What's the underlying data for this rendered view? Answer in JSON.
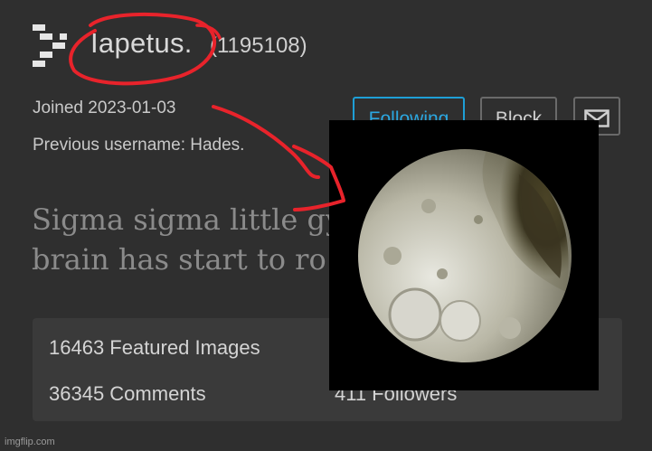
{
  "profile": {
    "username": "Iapetus.",
    "user_id": "(1195108)",
    "joined": "Joined 2023-01-03",
    "previous_username": "Previous username: Hades.",
    "bio": [
      "Sigma sigma little gy",
      "brain has start to ro"
    ]
  },
  "actions": {
    "following_label": "Following",
    "block_label": "Block",
    "message_icon": "envelope-icon"
  },
  "stats": {
    "featured": "16463 Featured Images",
    "comments": "36345 Comments",
    "followers": "411 Followers"
  },
  "overlay": {
    "image_subject": "moon Iapetus",
    "annotation_color": "#e8232b"
  },
  "watermark": "imgflip.com",
  "colors": {
    "background": "#2f2f2f",
    "accent": "#1e9fd6",
    "stats_panel": "#3a3a3a"
  }
}
